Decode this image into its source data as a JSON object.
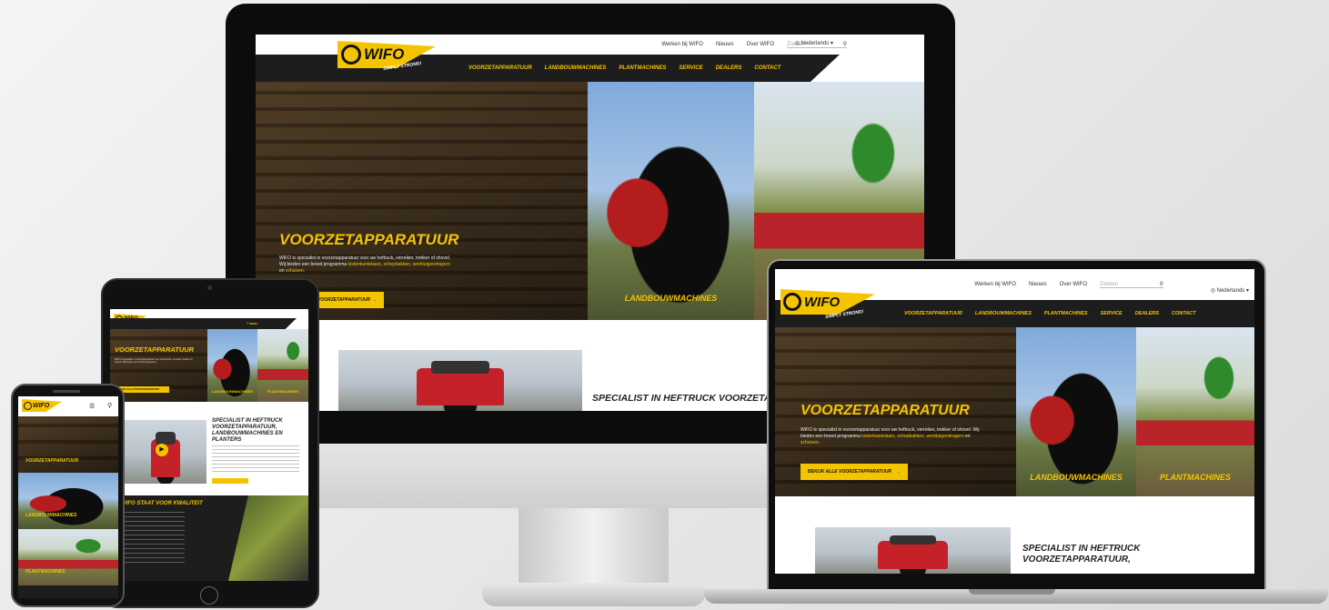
{
  "desktop": {
    "topnav": [
      "Werken bij WIFO",
      "Nieuws",
      "Over WIFO"
    ],
    "search_placeholder": "Zoeken",
    "language": "Nederlands",
    "logo_text": "WIFO",
    "logo_tagline": "SIMPLY STRONG!",
    "menu": [
      "VOORZETAPPARATUUR",
      "LANDBOUWMACHINES",
      "PLANTMACHINES",
      "SERVICE",
      "DEALERS",
      "CONTACT"
    ],
    "hero_title": "VOORZETAPPARATUUR",
    "hero_text_1": "WIFO is specialist in voorzetapparatuur voor uw heftruck, verreiker, trekker of shovel. Wij bieden een breed programma",
    "hero_link_1": "kistenkantelaars,",
    "hero_link_2": "schepbakken, werktuigendragers",
    "hero_text_2": "en",
    "hero_link_3": "schuiven.",
    "cta": "BEKIJK ALLE VOORZETAPPARATUUR",
    "panel_2": "LANDBOUWMACHINES",
    "panel_3": "PLANTMACHINES",
    "specialist_heading": "SPECIALIST IN HEFTRUCK VOORZETAPPARATUUR,",
    "specialist_heading_full": "SPECIALIST IN HEFTRUCK VOORZETAPPARATUUR, LANDBOUWMACHINES EN PLANTERS"
  },
  "tablet": {
    "quality_heading": "WIFO STAAT VOOR KWALITEIT"
  },
  "colors": {
    "accent": "#f5c400",
    "dark": "#1d1d1d",
    "brand_red": "#c52128"
  }
}
